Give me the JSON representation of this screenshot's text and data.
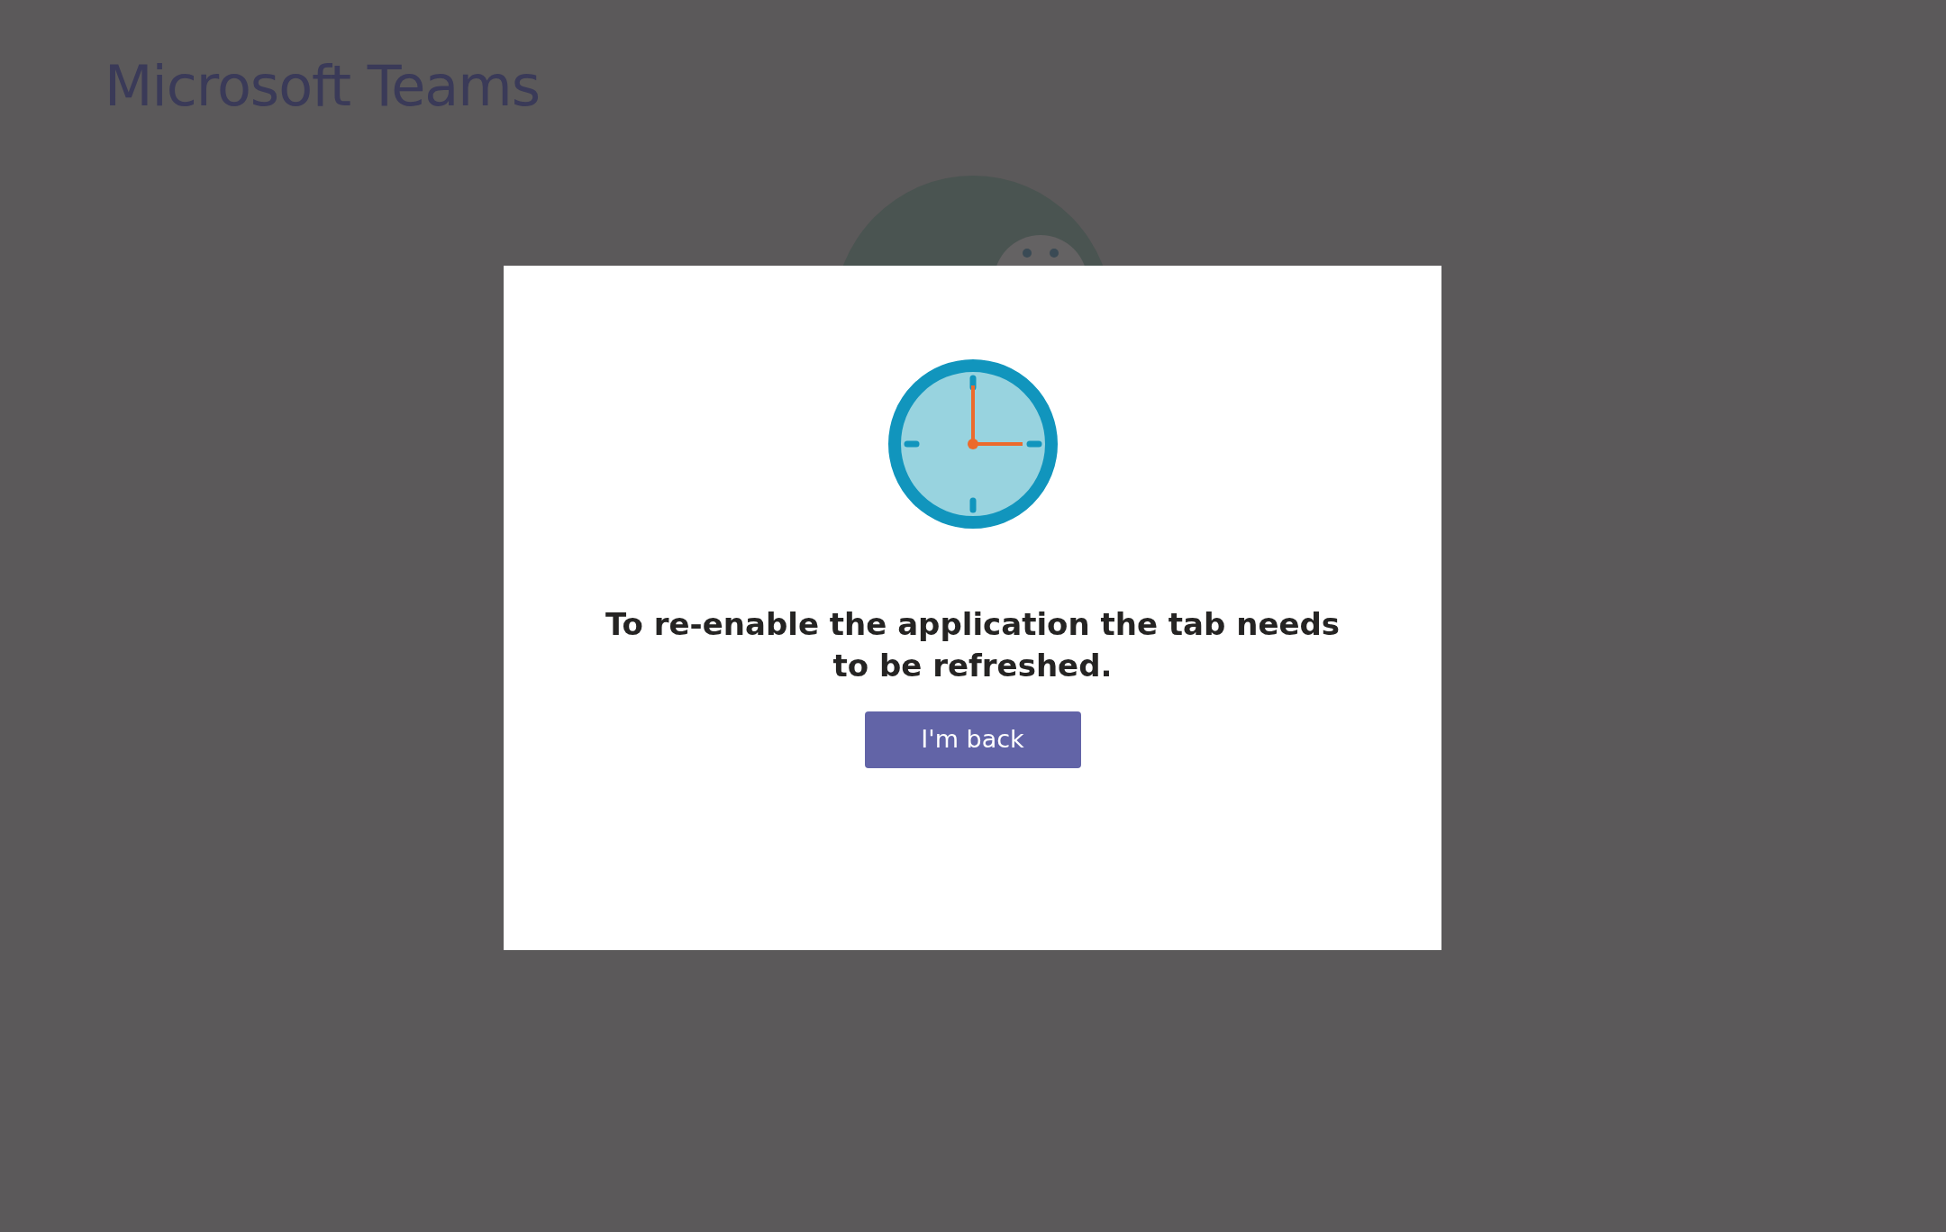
{
  "app_title": "Microsoft Teams",
  "dialog": {
    "message": "To re-enable the application the tab needs to be refreshed.",
    "button": "I'm back"
  }
}
